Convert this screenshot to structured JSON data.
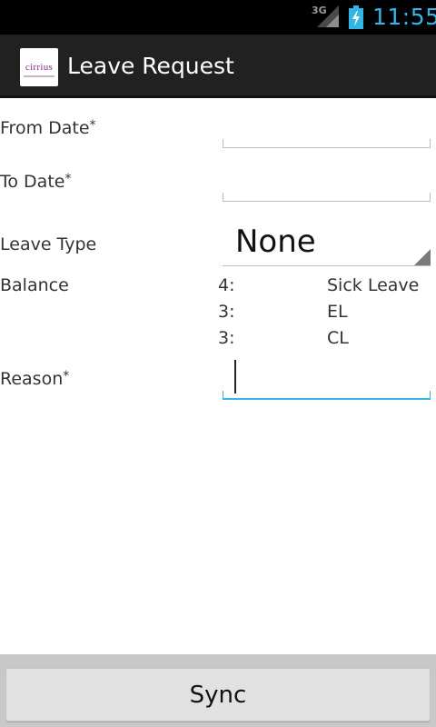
{
  "status_bar": {
    "network": "3G",
    "time": "11:55",
    "signal_icon": "signal-icon",
    "battery_icon": "battery-charging-icon"
  },
  "action_bar": {
    "title": "Leave Request",
    "logo_text": "cirrius",
    "logo_icon": "app-logo-icon"
  },
  "form": {
    "from_date": {
      "label": "From Date",
      "required_mark": "*",
      "value": ""
    },
    "to_date": {
      "label": "To Date",
      "required_mark": "*",
      "value": ""
    },
    "leave_type": {
      "label": "Leave Type",
      "selected": "None"
    },
    "balance": {
      "label": "Balance",
      "rows": [
        {
          "count": "4:",
          "type": "Sick Leave"
        },
        {
          "count": "3:",
          "type": "EL"
        },
        {
          "count": "3:",
          "type": "CL"
        }
      ]
    },
    "reason": {
      "label": "Reason",
      "required_mark": "*",
      "value": ""
    }
  },
  "footer": {
    "sync_label": "Sync"
  },
  "colors": {
    "accent": "#33b5e5",
    "action_bar_bg": "#212121",
    "status_bar_bg": "#000000",
    "bottom_bar_bg": "#c8c8c8"
  }
}
